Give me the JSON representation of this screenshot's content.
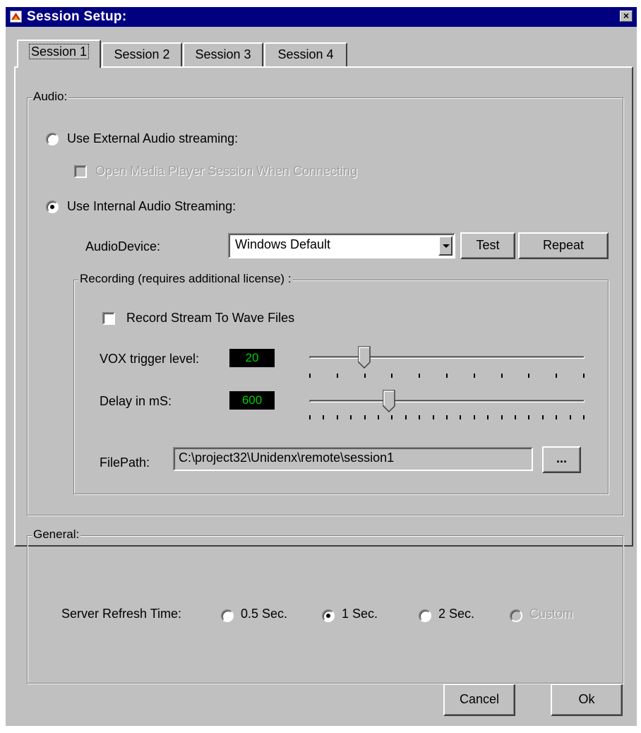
{
  "window": {
    "title": "Session Setup:",
    "close_glyph": "×"
  },
  "tabs": [
    {
      "label": "Session 1",
      "active": true
    },
    {
      "label": "Session 2",
      "active": false
    },
    {
      "label": "Session 3",
      "active": false
    },
    {
      "label": "Session 4",
      "active": false
    }
  ],
  "audio": {
    "legend": "Audio:",
    "external_radio_label": "Use External Audio streaming:",
    "external_selected": false,
    "open_media_player_label": "Open Media Player Session When Connecting",
    "open_media_player_checked": false,
    "internal_radio_label": "Use Internal Audio Streaming:",
    "internal_selected": true,
    "audio_device_label": "AudioDevice:",
    "audio_device_value": "Windows Default",
    "test_button": "Test",
    "repeat_button": "Repeat",
    "recording": {
      "legend": "Recording (requires additional license) :",
      "record_checkbox_label": "Record Stream To Wave Files",
      "record_checked": false,
      "vox_label": "VOX trigger level:",
      "vox_value": "20",
      "vox_slider_fraction": 0.2,
      "delay_label": "Delay in mS:",
      "delay_value": "600",
      "delay_slider_fraction": 0.29,
      "filepath_label": "FilePath:",
      "filepath_value": "C:\\project32\\Unidenx\\remote\\session1",
      "browse_button": "..."
    }
  },
  "general": {
    "legend": "General:",
    "refresh_label": "Server Refresh Time:",
    "options": [
      {
        "label": "0.5 Sec.",
        "selected": false,
        "disabled": false
      },
      {
        "label": "1 Sec.",
        "selected": true,
        "disabled": false
      },
      {
        "label": "2 Sec.",
        "selected": false,
        "disabled": false
      },
      {
        "label": "Custom",
        "selected": false,
        "disabled": true
      }
    ]
  },
  "footer": {
    "cancel_button": "Cancel",
    "ok_button": "Ok"
  },
  "colors": {
    "titlebar": "#000080",
    "face": "#c0c0c0",
    "lcd_bg": "#000000",
    "lcd_text": "#00d000"
  },
  "icons": {
    "app": "app-logo-icon",
    "close": "close-icon"
  }
}
